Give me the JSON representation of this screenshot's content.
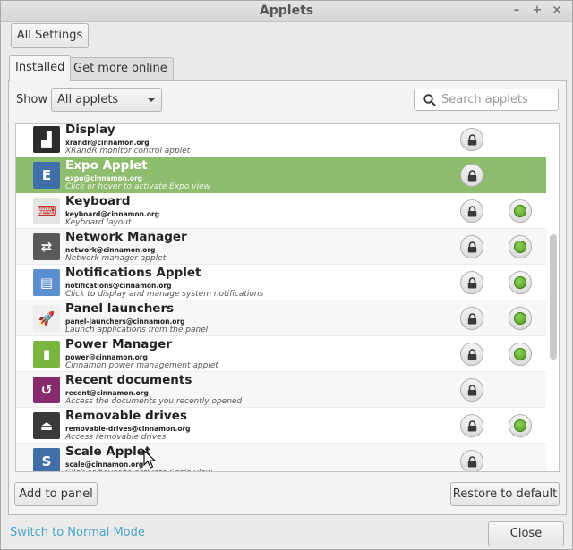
{
  "window": {
    "title": "Applets"
  },
  "header": {
    "all_settings": "All Settings"
  },
  "tabs": [
    {
      "label": "Installed",
      "active": true
    },
    {
      "label": "Get more online",
      "active": false
    }
  ],
  "filter": {
    "show_label": "Show",
    "selected": "All applets"
  },
  "search": {
    "placeholder": "Search applets",
    "value": ""
  },
  "applets": [
    {
      "name": "Display",
      "uuid": "xrandr@cinnamon.org",
      "desc": "XRandR monitor control applet",
      "enabled": false,
      "icon": "display-icon",
      "icon_color": "#2b2b2b",
      "icon_glyph": "▟",
      "selected": false
    },
    {
      "name": "Expo Applet",
      "uuid": "expo@cinnamon.org",
      "desc": "Click or hover to activate Expo view",
      "enabled": false,
      "icon": "expo-icon",
      "icon_color": "#3f6ea8",
      "icon_glyph": "E",
      "selected": true
    },
    {
      "name": "Keyboard",
      "uuid": "keyboard@cinnamon.org",
      "desc": "Keyboard layout",
      "enabled": true,
      "icon": "keyboard-icon",
      "icon_color": "#e4e4e4",
      "icon_glyph": "⌨",
      "selected": false
    },
    {
      "name": "Network Manager",
      "uuid": "network@cinnamon.org",
      "desc": "Network manager applet",
      "enabled": true,
      "icon": "network-icon",
      "icon_color": "#5a5a5a",
      "icon_glyph": "⇄",
      "selected": false
    },
    {
      "name": "Notifications Applet",
      "uuid": "notifications@cinnamon.org",
      "desc": "Click to display and manage system notifications",
      "enabled": true,
      "icon": "notifications-icon",
      "icon_color": "#5b8fcf",
      "icon_glyph": "▤",
      "selected": false
    },
    {
      "name": "Panel launchers",
      "uuid": "panel-launchers@cinnamon.org",
      "desc": "Launch applications from the panel",
      "enabled": true,
      "icon": "rocket-icon",
      "icon_color": "#efefef",
      "icon_glyph": "🚀",
      "selected": false
    },
    {
      "name": "Power Manager",
      "uuid": "power@cinnamon.org",
      "desc": "Cinnamon power management applet",
      "enabled": true,
      "icon": "battery-icon",
      "icon_color": "#7ab53f",
      "icon_glyph": "▮",
      "selected": false
    },
    {
      "name": "Recent documents",
      "uuid": "recent@cinnamon.org",
      "desc": "Access the documents you recently opened",
      "enabled": false,
      "icon": "recent-icon",
      "icon_color": "#8a2a6e",
      "icon_glyph": "↺",
      "selected": false
    },
    {
      "name": "Removable drives",
      "uuid": "removable-drives@cinnamon.org",
      "desc": "Access removable drives",
      "enabled": true,
      "icon": "eject-icon",
      "icon_color": "#3a3a3a",
      "icon_glyph": "⏏",
      "selected": false
    },
    {
      "name": "Scale Applet",
      "uuid": "scale@cinnamon.org",
      "desc": "Click or hover to activate Scale view",
      "enabled": false,
      "icon": "scale-icon",
      "icon_color": "#3f6ea8",
      "icon_glyph": "S",
      "selected": false
    }
  ],
  "actions": {
    "add": "Add to panel",
    "restore": "Restore to default"
  },
  "footer": {
    "mode_link": "Switch to Normal Mode",
    "close": "Close"
  },
  "colors": {
    "selected_row": "#8dbd6d",
    "link": "#4ca3c4",
    "enabled_dot": "#5fae2a"
  }
}
